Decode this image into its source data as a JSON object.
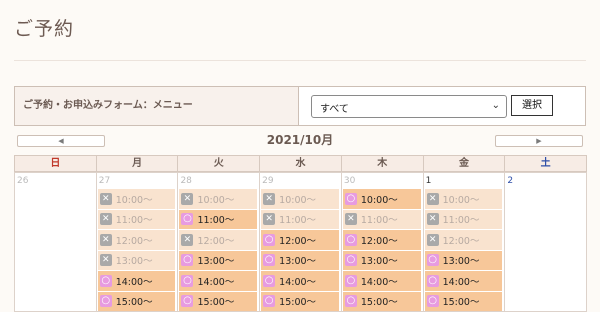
{
  "page": {
    "title": "ご予約"
  },
  "form": {
    "label": "ご予約・お申込みフォーム：メニュー",
    "select_value": "すべて",
    "button_label": "選択"
  },
  "calendar": {
    "month": "2021/10月",
    "prev_arrow": "◀",
    "next_arrow": "▶",
    "weekdays": [
      "日",
      "月",
      "火",
      "水",
      "木",
      "金",
      "土"
    ],
    "days": [
      {
        "num": "26",
        "current": false,
        "slots": []
      },
      {
        "num": "27",
        "current": false,
        "slots": [
          {
            "status": "full",
            "time": "10:00〜"
          },
          {
            "status": "full",
            "time": "11:00〜"
          },
          {
            "status": "full",
            "time": "12:00〜"
          },
          {
            "status": "full",
            "time": "13:00〜"
          },
          {
            "status": "open",
            "time": "14:00〜"
          },
          {
            "status": "open",
            "time": "15:00〜"
          }
        ]
      },
      {
        "num": "28",
        "current": false,
        "slots": [
          {
            "status": "full",
            "time": "10:00〜"
          },
          {
            "status": "open",
            "time": "11:00〜"
          },
          {
            "status": "full",
            "time": "12:00〜"
          },
          {
            "status": "open",
            "time": "13:00〜"
          },
          {
            "status": "open",
            "time": "14:00〜"
          },
          {
            "status": "open",
            "time": "15:00〜"
          }
        ]
      },
      {
        "num": "29",
        "current": false,
        "slots": [
          {
            "status": "full",
            "time": "10:00〜"
          },
          {
            "status": "full",
            "time": "11:00〜"
          },
          {
            "status": "open",
            "time": "12:00〜"
          },
          {
            "status": "open",
            "time": "13:00〜"
          },
          {
            "status": "open",
            "time": "14:00〜"
          },
          {
            "status": "open",
            "time": "15:00〜"
          }
        ]
      },
      {
        "num": "30",
        "current": false,
        "slots": [
          {
            "status": "open",
            "time": "10:00〜"
          },
          {
            "status": "full",
            "time": "11:00〜"
          },
          {
            "status": "open",
            "time": "12:00〜"
          },
          {
            "status": "open",
            "time": "13:00〜"
          },
          {
            "status": "open",
            "time": "14:00〜"
          },
          {
            "status": "open",
            "time": "15:00〜"
          }
        ]
      },
      {
        "num": "1",
        "current": true,
        "slots": [
          {
            "status": "full",
            "time": "10:00〜"
          },
          {
            "status": "full",
            "time": "11:00〜"
          },
          {
            "status": "full",
            "time": "12:00〜"
          },
          {
            "status": "open",
            "time": "13:00〜"
          },
          {
            "status": "open",
            "time": "14:00〜"
          },
          {
            "status": "open",
            "time": "15:00〜"
          }
        ]
      },
      {
        "num": "2",
        "current": true,
        "slots": []
      }
    ]
  }
}
